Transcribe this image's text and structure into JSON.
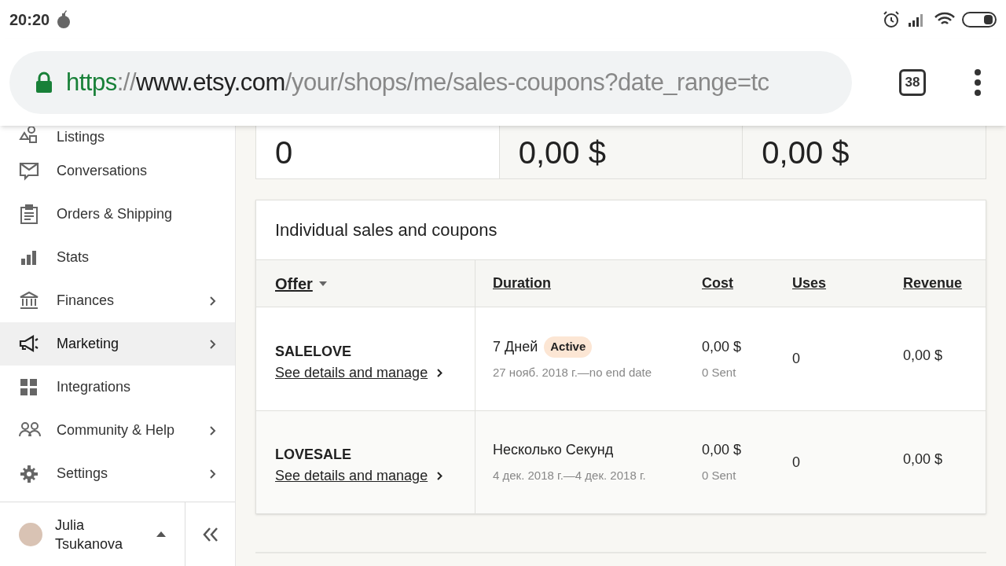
{
  "status_bar": {
    "time": "20:20"
  },
  "browser": {
    "url_scheme": "https",
    "url_separator": "://",
    "url_host": "www.etsy.com",
    "url_path": "/your/shops/me/sales-coupons?date_range=tc",
    "tab_count": "38"
  },
  "sidebar": {
    "items": [
      {
        "label": "Listings",
        "has_submenu": false,
        "selected": false
      },
      {
        "label": "Conversations",
        "has_submenu": false,
        "selected": false
      },
      {
        "label": "Orders & Shipping",
        "has_submenu": false,
        "selected": false
      },
      {
        "label": "Stats",
        "has_submenu": false,
        "selected": false
      },
      {
        "label": "Finances",
        "has_submenu": true,
        "selected": false
      },
      {
        "label": "Marketing",
        "has_submenu": true,
        "selected": true
      },
      {
        "label": "Integrations",
        "has_submenu": false,
        "selected": false
      },
      {
        "label": "Community & Help",
        "has_submenu": true,
        "selected": false
      },
      {
        "label": "Settings",
        "has_submenu": true,
        "selected": false
      }
    ],
    "user": {
      "first_name": "Julia",
      "last_name": "Tsukanova"
    }
  },
  "summary": [
    "0",
    "0,00 $",
    "0,00 $"
  ],
  "sales": {
    "title": "Individual sales and coupons",
    "columns": [
      {
        "label": "Offer",
        "sorted": true
      },
      {
        "label": "Duration",
        "sorted": false
      },
      {
        "label": "Cost",
        "sorted": false
      },
      {
        "label": "Uses",
        "sorted": false
      },
      {
        "label": "Revenue",
        "sorted": false
      }
    ],
    "rows": [
      {
        "code": "SALELOVE",
        "link": "See details and manage",
        "duration": "7 Дней",
        "badge": "Active",
        "dates": "27 нояб. 2018 г.—no end date",
        "cost": "0,00 $",
        "sent": "0 Sent",
        "uses": "0",
        "revenue": "0,00 $"
      },
      {
        "code": "LOVESALE",
        "link": "See details and manage",
        "duration": "Несколько Секунд",
        "dates": "4 дек. 2018 г.—4 дек. 2018 г.",
        "cost": "0,00 $",
        "sent": "0 Sent",
        "uses": "0",
        "revenue": "0,00 $"
      }
    ]
  }
}
